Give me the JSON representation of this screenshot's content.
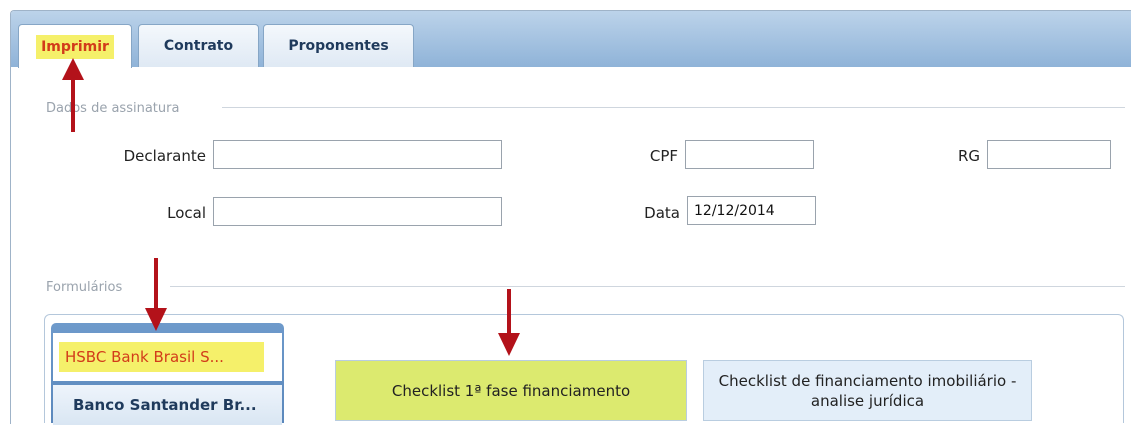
{
  "tabs": [
    {
      "label": "Imprimir",
      "active": true
    },
    {
      "label": "Contrato",
      "active": false
    },
    {
      "label": "Proponentes",
      "active": false
    }
  ],
  "signature_section": {
    "legend": "Dados de assinatura",
    "declarante_label": "Declarante",
    "declarante_value": "",
    "cpf_label": "CPF",
    "cpf_value": "",
    "rg_label": "RG",
    "rg_value": "",
    "local_label": "Local",
    "local_value": "",
    "data_label": "Data",
    "data_value": "12/12/2014"
  },
  "forms_section": {
    "legend": "Formulários",
    "banks": [
      {
        "label": "HSBC Bank Brasil S...",
        "active": true
      },
      {
        "label": "Banco Santander Br...",
        "active": false
      }
    ],
    "buttons": [
      {
        "label": "Checklist 1ª fase financiamento"
      },
      {
        "label_line1": "Checklist de financiamento imobiliário -",
        "label_line2": "analise jurídica"
      }
    ]
  },
  "colors": {
    "highlight": "#f5f06a",
    "highlight_text": "#d23b1a",
    "annotation_arrow": "#b3121a",
    "tab_strip": "#8fb3d8"
  }
}
